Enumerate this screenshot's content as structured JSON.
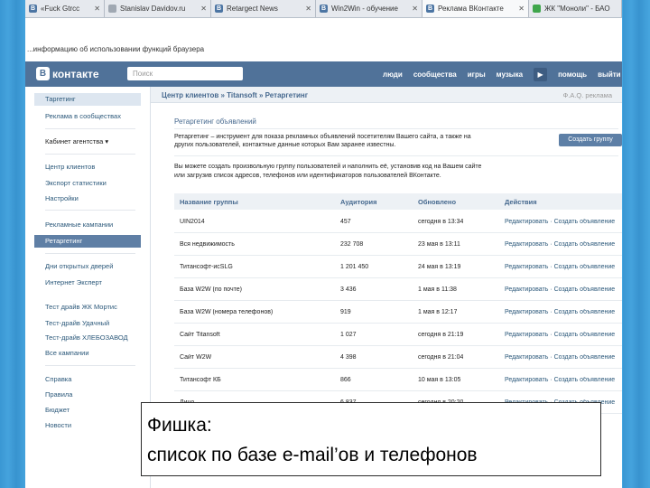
{
  "tabs": [
    {
      "label": "«Fuck Gtrcc",
      "icon": "vk-icon",
      "active": false
    },
    {
      "label": "Stanislav Davidov.ru",
      "icon": "page-icon",
      "active": false
    },
    {
      "label": "Retargect News",
      "icon": "vk-icon",
      "active": false
    },
    {
      "label": "Win2Win - обучение",
      "icon": "vk-icon",
      "active": false
    },
    {
      "label": "Реклама ВКонтакте",
      "icon": "vk-icon",
      "active": true
    },
    {
      "label": "ЖК \"Моноли\" - БАО",
      "icon": "green-icon",
      "active": false
    }
  ],
  "infobar": {
    "text": "...информацию об использовании функций браузера"
  },
  "header": {
    "logo_badge": "В",
    "logo_text": "контакте",
    "search_placeholder": "Поиск",
    "nav": [
      "люди",
      "сообщества",
      "игры",
      "музыка",
      "помощь",
      "выйти"
    ],
    "play_icon": "▶"
  },
  "sidebar": {
    "items": [
      {
        "label": "Таргетинг",
        "style": "sel-light"
      },
      {
        "label": "Реклама в сообществах",
        "style": ""
      },
      {
        "label": "Кабинет агентства ▾",
        "style": "dark"
      },
      {
        "label": "Центр клиентов",
        "style": ""
      },
      {
        "label": "Экспорт статистики",
        "style": ""
      },
      {
        "label": "Настройки",
        "style": ""
      },
      {
        "label": "Рекламные кампании",
        "style": ""
      },
      {
        "label": "Ретаргетинг",
        "style": "sel"
      },
      {
        "label": "Дни открытых дверей",
        "style": ""
      },
      {
        "label": "Интернет Эксперт",
        "style": ""
      },
      {
        "label": "Тест драйв ЖК Мортис",
        "style": ""
      },
      {
        "label": "Тест-драйв Удачный",
        "style": ""
      },
      {
        "label": "Тест-драйв ХЛЕБОЗАВОД",
        "style": ""
      },
      {
        "label": "Все кампании",
        "style": ""
      },
      {
        "label": "Справка",
        "style": ""
      },
      {
        "label": "Правила",
        "style": ""
      },
      {
        "label": "Бюджет",
        "style": ""
      },
      {
        "label": "Новости",
        "style": ""
      }
    ]
  },
  "main": {
    "breadcrumb": "Центр клиентов » Titansoft » Ретаргетинг",
    "help": "Ф.А.Q. реклама",
    "section_title": "Ретаргетинг объявлений",
    "intro": [
      "Ретаргетинг – инструмент для показа рекламных объявлений посетителям Вашего сайта, а также на",
      "других пользователей, контактные данные которых Вам заранее известны."
    ],
    "create_button": "Создать группу",
    "note": [
      "Вы можете создать произвольную группу пользователей и наполнить её, установив код на Вашем сайте",
      "или загрузив список адресов, телефонов или идентификаторов пользователей ВКонтакте."
    ],
    "table": {
      "headers": [
        "Название группы",
        "Аудитория",
        "Обновлено",
        "Действия"
      ],
      "rows": [
        {
          "name": "UIN2014",
          "audience": "457",
          "updated": "сегодня в 13:34",
          "actions": "Редактировать · Создать объявление"
        },
        {
          "name": "Вся недвижимость",
          "audience": "232 708",
          "updated": "23 мая в 13:11",
          "actions": "Редактировать · Создать объявление"
        },
        {
          "name": "Титансофт-исSLG",
          "audience": "1 201 450",
          "updated": "24 мая в 13:19",
          "actions": "Редактировать · Создать объявление"
        },
        {
          "name": "База W2W (по почте)",
          "audience": "3 436",
          "updated": "1 мая в 11:38",
          "actions": "Редактировать · Создать объявление"
        },
        {
          "name": "База W2W (номера телефонов)",
          "audience": "919",
          "updated": "1 мая в 12:17",
          "actions": "Редактировать · Создать объявление"
        },
        {
          "name": "Сайт Titansoft",
          "audience": "1 027",
          "updated": "сегодня в 21:19",
          "actions": "Редактировать · Создать объявление"
        },
        {
          "name": "Сайт W2W",
          "audience": "4 398",
          "updated": "сегодня в 21:04",
          "actions": "Редактировать · Создать объявление"
        },
        {
          "name": "Титансофт КБ",
          "audience": "866",
          "updated": "10 мая в 13:05",
          "actions": "Редактировать · Создать объявление"
        },
        {
          "name": "Лицо",
          "audience": "6 837",
          "updated": "сегодня в 20:20",
          "actions": "Редактировать · Создать объявление"
        }
      ]
    }
  },
  "caption": {
    "line1": "Фишка:",
    "line2": "список по базе e-mail’ов и телефонов"
  }
}
